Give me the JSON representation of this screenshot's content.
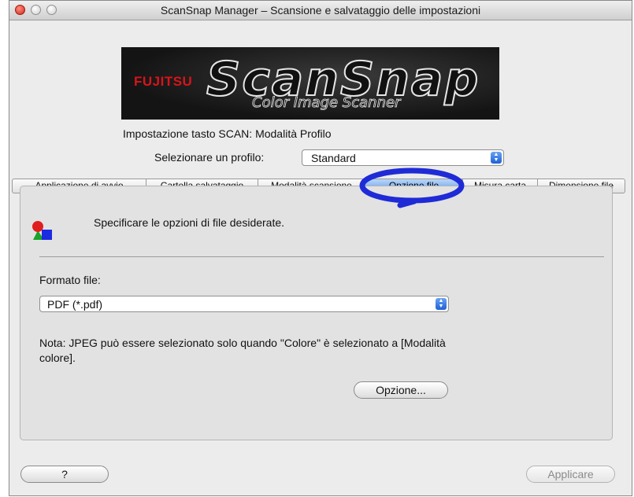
{
  "window": {
    "title": "ScanSnap Manager – Scansione e salvataggio delle impostazioni"
  },
  "logo": {
    "brand": "FUJITSU",
    "product": "ScanSnap",
    "tagline": "Color Image Scanner"
  },
  "header": {
    "scan_setting": "Impostazione tasto SCAN: Modalità Profilo",
    "profile_label": "Selezionare un profilo:",
    "profile_value": "Standard"
  },
  "tabs": [
    {
      "label": "Applicazione di avvio",
      "selected": false
    },
    {
      "label": "Cartella salvataggio",
      "selected": false
    },
    {
      "label": "Modalità scansione",
      "selected": false
    },
    {
      "label": "Opzione file",
      "selected": true
    },
    {
      "label": "Misura carta",
      "selected": false
    },
    {
      "label": "Dimensione file",
      "selected": false
    }
  ],
  "panel": {
    "intro": "Specificare le opzioni di file desiderate.",
    "format_label": "Formato file:",
    "format_value": "PDF (*.pdf)",
    "note": "Nota: JPEG può essere selezionato solo quando \"Colore\" è selezionato a [Modalità colore].",
    "option_button": "Opzione..."
  },
  "footer": {
    "help_button": "?",
    "apply_button": "Applicare",
    "apply_enabled": false
  },
  "icons": {
    "window_close": "close-traffic-light-icon",
    "window_minimize": "minimize-traffic-light-icon",
    "window_zoom": "zoom-traffic-light-icon",
    "select_arrows": "up-down-arrows-icon",
    "panel": "file-options-shapes-icon"
  },
  "colors": {
    "selected_tab": "#5b98e8",
    "highlight_marker": "#1f2bd6",
    "brand_red": "#d8141a"
  }
}
